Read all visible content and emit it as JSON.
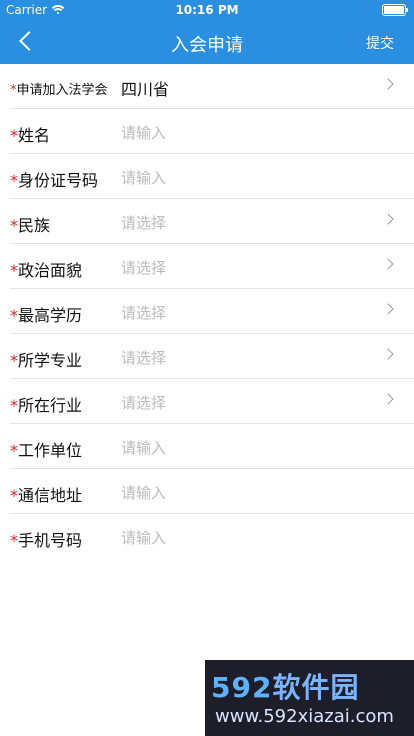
{
  "status": {
    "carrier": "Carrier",
    "time": "10:16 PM"
  },
  "nav": {
    "title": "入会申请",
    "submit": "提交"
  },
  "form": {
    "required_mark": "*",
    "rows": [
      {
        "label": "申请加入法学会",
        "value": "四川省",
        "placeholder": "",
        "type": "select",
        "filled": true
      },
      {
        "label": "姓名",
        "value": "",
        "placeholder": "请输入",
        "type": "input",
        "filled": false
      },
      {
        "label": "身份证号码",
        "value": "",
        "placeholder": "请输入",
        "type": "input",
        "filled": false
      },
      {
        "label": "民族",
        "value": "",
        "placeholder": "请选择",
        "type": "select",
        "filled": false
      },
      {
        "label": "政治面貌",
        "value": "",
        "placeholder": "请选择",
        "type": "select",
        "filled": false
      },
      {
        "label": "最高学历",
        "value": "",
        "placeholder": "请选择",
        "type": "select",
        "filled": false
      },
      {
        "label": "所学专业",
        "value": "",
        "placeholder": "请选择",
        "type": "select",
        "filled": false
      },
      {
        "label": "所在行业",
        "value": "",
        "placeholder": "请选择",
        "type": "select",
        "filled": false
      },
      {
        "label": "工作单位",
        "value": "",
        "placeholder": "请输入",
        "type": "input",
        "filled": false
      },
      {
        "label": "通信地址",
        "value": "",
        "placeholder": "请输入",
        "type": "input",
        "filled": false
      },
      {
        "label": "手机号码",
        "value": "",
        "placeholder": "请输入",
        "type": "input",
        "filled": false
      }
    ]
  },
  "watermark": {
    "brand_num": "592",
    "brand_text": "软件园",
    "url": "www.592xiazai.com"
  }
}
